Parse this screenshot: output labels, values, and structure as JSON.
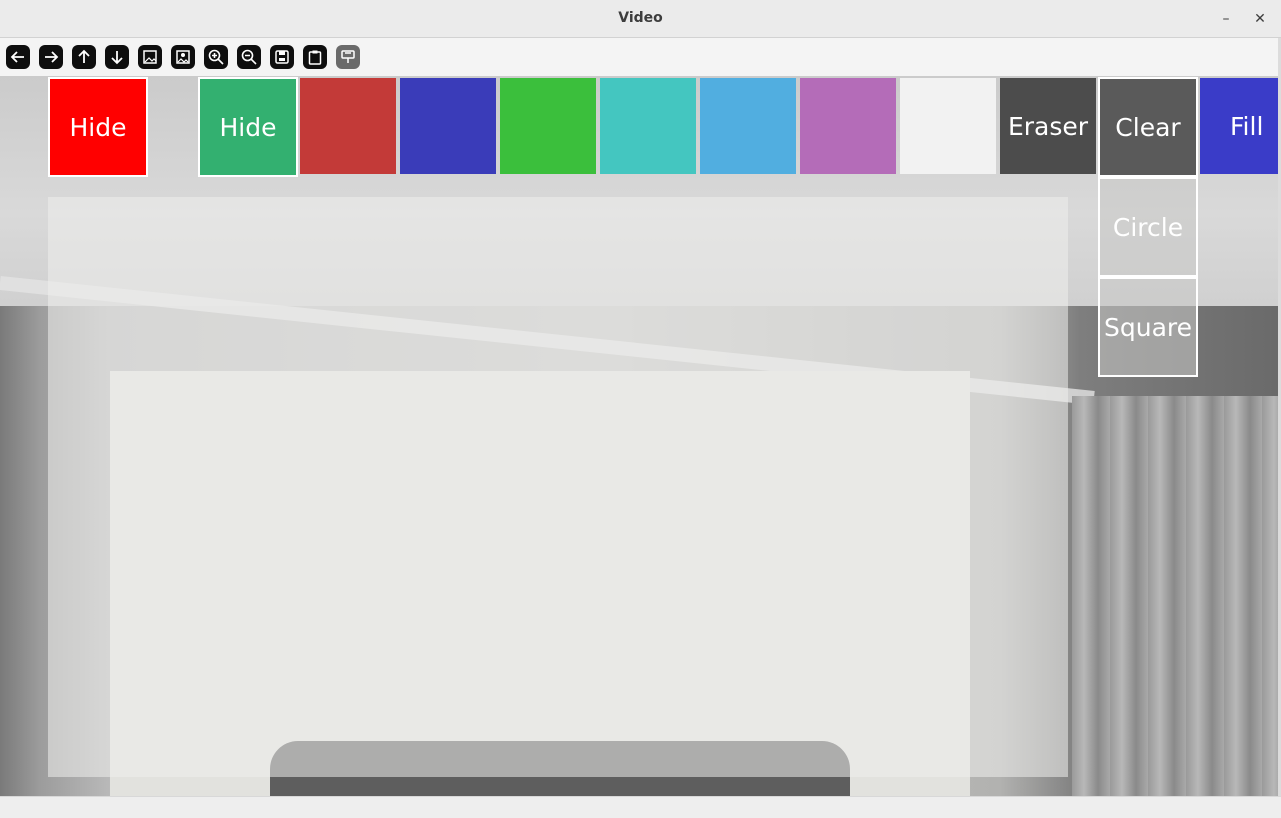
{
  "window": {
    "title": "Video",
    "minimize_glyph": "–",
    "close_glyph": "✕"
  },
  "toolbar": {
    "icons": [
      "arrow-left-icon",
      "arrow-right-icon",
      "arrow-up-icon",
      "arrow-down-icon",
      "image-icon",
      "image-save-icon",
      "zoom-in-icon",
      "zoom-out-icon",
      "save-icon",
      "clipboard-icon",
      "properties-icon"
    ]
  },
  "palette": {
    "hide_left": {
      "label": "Hide",
      "color": "#ff0000"
    },
    "hide_right": {
      "label": "Hide",
      "color": "#33b070"
    },
    "swatches": [
      "#c33a38",
      "#3a3cb9",
      "#3bbf3c",
      "#44c6c0",
      "#51aee0",
      "#b46cb8",
      "#f2f2f2"
    ],
    "eraser": {
      "label": "Eraser",
      "color": "#4c4c4c"
    },
    "clear": {
      "label": "Clear",
      "color": "#5a5a5a"
    },
    "fill": {
      "label": "Fill",
      "color": "#3a3cc8"
    },
    "circle": {
      "label": "Circle"
    },
    "square": {
      "label": "Square"
    }
  }
}
